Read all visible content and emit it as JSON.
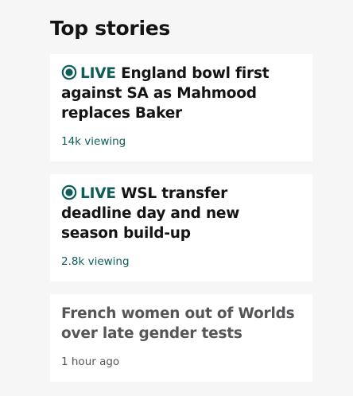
{
  "section": {
    "title": "Top stories"
  },
  "colors": {
    "live_accent": "#0d5d59",
    "headline": "#141414",
    "headline_muted": "#545658",
    "background": "#f6f6f6",
    "card": "#ffffff"
  },
  "stories": [
    {
      "live": true,
      "live_label": "LIVE",
      "icon": "live-icon",
      "headline": "England bowl first against SA as Mahmood replaces Baker",
      "meta": "14k viewing"
    },
    {
      "live": true,
      "live_label": "LIVE",
      "icon": "live-icon",
      "headline": "WSL transfer deadline day and new season build-up",
      "meta": "2.8k viewing"
    },
    {
      "live": false,
      "headline": "French women out of Worlds over late gender tests",
      "meta": "1 hour ago"
    }
  ]
}
